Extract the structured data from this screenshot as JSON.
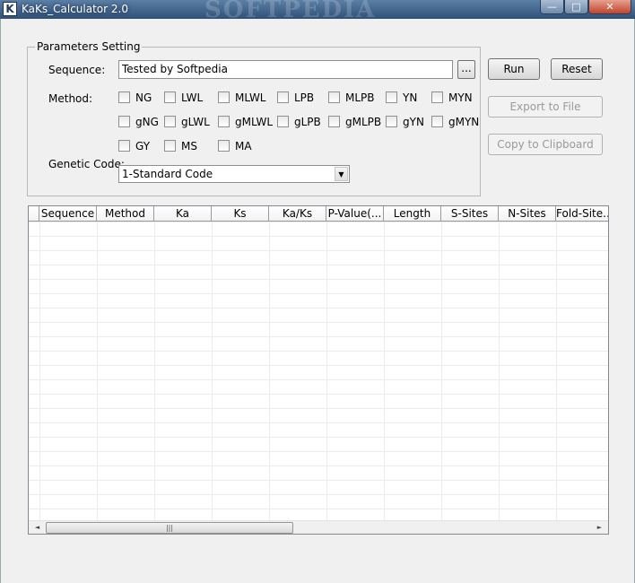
{
  "window": {
    "title": "KaKs_Calculator 2.0",
    "icon_letter": "K",
    "watermark": "SOFTPEDIA",
    "controls": {
      "minimize": "—",
      "maximize": "□",
      "close": "✕"
    }
  },
  "params": {
    "group_title": "Parameters Setting",
    "sequence_label": "Sequence:",
    "sequence_value": "Tested by Softpedia",
    "browse_label": "...",
    "method_label": "Method:",
    "methods_row1": [
      "NG",
      "LWL",
      "MLWL",
      "LPB",
      "MLPB",
      "YN",
      "MYN"
    ],
    "methods_row2": [
      "gNG",
      "gLWL",
      "gMLWL",
      "gLPB",
      "gMLPB",
      "gYN",
      "gMYN"
    ],
    "methods_row3": [
      "GY",
      "MS",
      "MA"
    ],
    "genetic_code_label": "Genetic Code:",
    "genetic_code_value": "1-Standard Code",
    "combo_arrow": "▼"
  },
  "buttons": {
    "run": "Run",
    "reset": "Reset",
    "export": "Export to File",
    "copy": "Copy to Clipboard"
  },
  "table": {
    "columns": [
      "Sequence",
      "Method",
      "Ka",
      "Ks",
      "Ka/Ks",
      "P-Value(...",
      "Length",
      "S-Sites",
      "N-Sites",
      "Fold-Site..."
    ],
    "scroll_left": "◄",
    "scroll_right": "►",
    "scroll_grip": "|||"
  }
}
